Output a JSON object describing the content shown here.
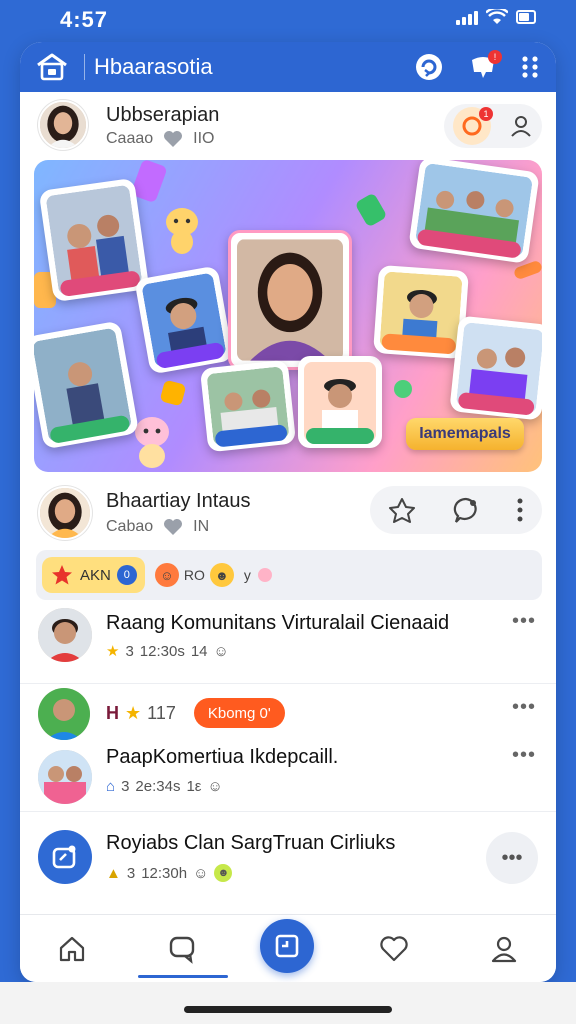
{
  "status": {
    "time": "4:57"
  },
  "app": {
    "title": "Hbaarasotia"
  },
  "post1": {
    "author": "Ubbserapian",
    "meta_label": "Caaao",
    "meta_count": "IIO",
    "badge_count": "1"
  },
  "banner": {
    "label": "Iamemapals"
  },
  "post2": {
    "author": "Bhaartiay Intaus",
    "meta_label": "Cabao",
    "meta_count": "IN"
  },
  "reactions": {
    "pill_label": "AKN",
    "pill_count": "0",
    "item2_label": "RO",
    "item3_label": "y"
  },
  "feed": [
    {
      "title": "Raang Komunitans Virturalail Cienaaid",
      "meta_count": "3",
      "meta_time": "12:30s",
      "meta_extra": "14"
    },
    {
      "title_prefix": "H",
      "meta_count": "117",
      "pill": "Kbomg 0'",
      "sub_title": "PaapKomertiua Ikdepcaill.",
      "sub_count": "3",
      "sub_time": "2e:34s",
      "sub_extra": "1ε"
    },
    {
      "title": "Royiabs Clan SargTruan Cirliuks",
      "meta_count": "3",
      "meta_time": "12:30h"
    }
  ],
  "colors": {
    "primary": "#2d66d2",
    "accent_orange": "#ff5b1f",
    "accent_yellow": "#ffc83d"
  },
  "icons": [
    "home-icon",
    "chat-icon",
    "compose-icon",
    "heart-icon",
    "profile-icon",
    "apps-grid-icon",
    "notification-icon",
    "sync-icon"
  ]
}
